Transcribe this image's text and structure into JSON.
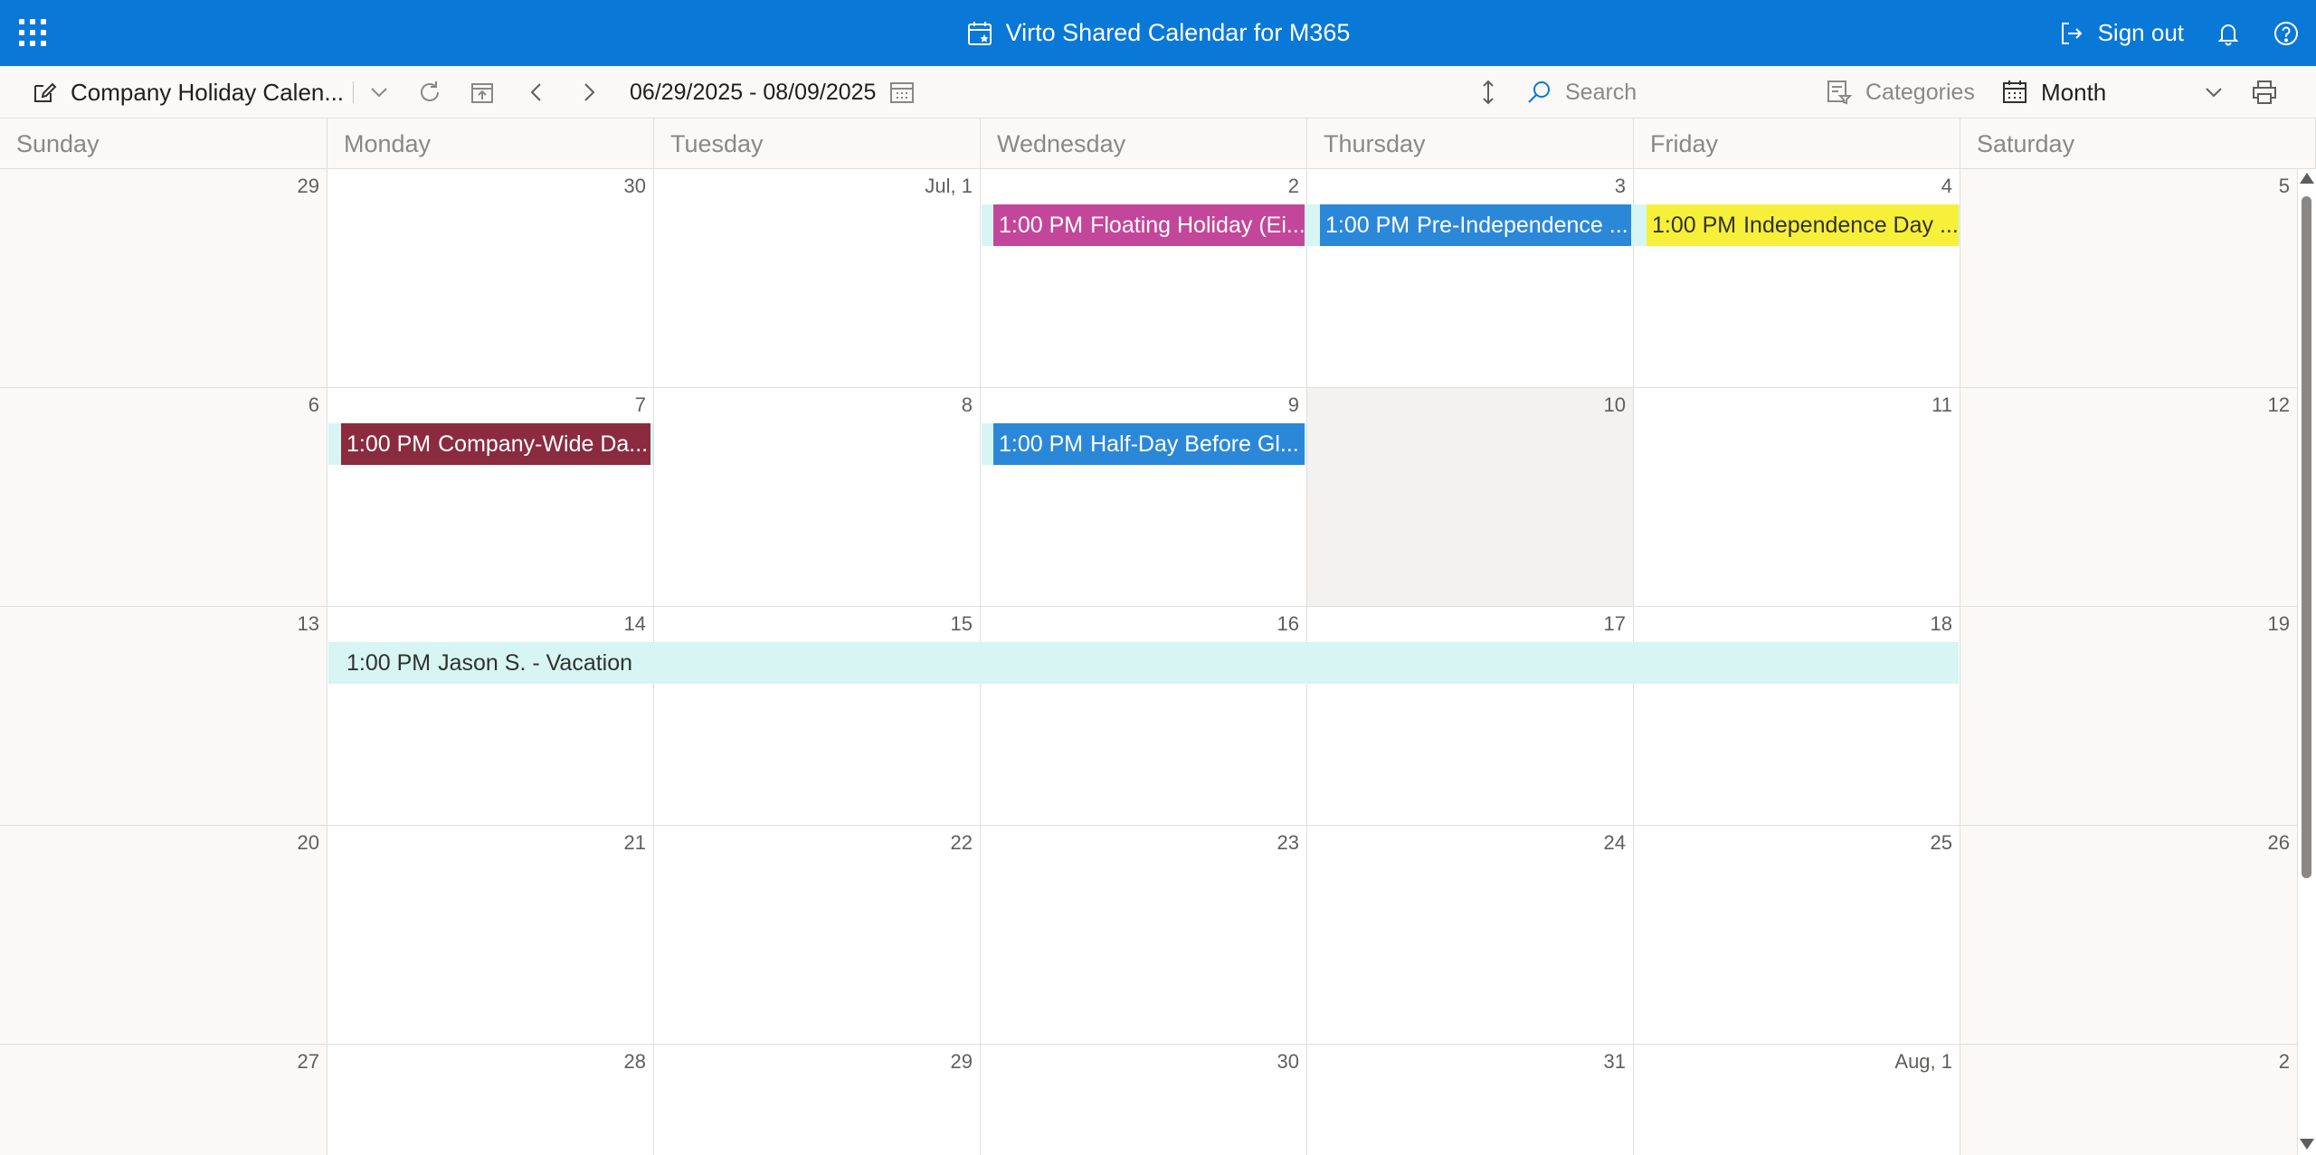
{
  "app": {
    "title": "Virto Shared Calendar for M365",
    "sign_out_label": "Sign out",
    "brand_color": "#0a78d7"
  },
  "toolbar": {
    "calendar_name": "Company Holiday Calen...",
    "date_range": "06/29/2025 - 08/09/2025",
    "search_placeholder": "Search",
    "categories_label": "Categories",
    "view_label": "Month"
  },
  "calendar": {
    "days_of_week": [
      "Sunday",
      "Monday",
      "Tuesday",
      "Wednesday",
      "Thursday",
      "Friday",
      "Saturday"
    ],
    "weeks": [
      [
        "29",
        "30",
        "Jul, 1",
        "2",
        "3",
        "4",
        "5"
      ],
      [
        "6",
        "7",
        "8",
        "9",
        "10",
        "11",
        "12"
      ],
      [
        "13",
        "14",
        "15",
        "16",
        "17",
        "18",
        "19"
      ],
      [
        "20",
        "21",
        "22",
        "23",
        "24",
        "25",
        "26"
      ],
      [
        "27",
        "28",
        "29",
        "30",
        "31",
        "Aug, 1",
        "2"
      ]
    ],
    "today_label": "10",
    "events": [
      {
        "time": "1:00 PM",
        "title": "Floating Holiday (Ei...",
        "color": "#c2479b",
        "text_color": "#ffffff"
      },
      {
        "time": "1:00 PM",
        "title": "Pre-Independence ...",
        "color": "#2b88d8",
        "text_color": "#ffffff"
      },
      {
        "time": "1:00 PM",
        "title": "Independence Day ...",
        "color": "#f7f03a",
        "text_color": "#323130"
      },
      {
        "time": "1:00 PM",
        "title": "Company-Wide Da...",
        "color": "#8b2b3f",
        "text_color": "#ffffff"
      },
      {
        "time": "1:00 PM",
        "title": "Half-Day Before Gl...",
        "color": "#2b88d8",
        "text_color": "#ffffff"
      },
      {
        "time": "1:00 PM",
        "title": "Jason S. - Vacation",
        "color": "#d6f5f3",
        "text_color": "#323130"
      }
    ]
  }
}
